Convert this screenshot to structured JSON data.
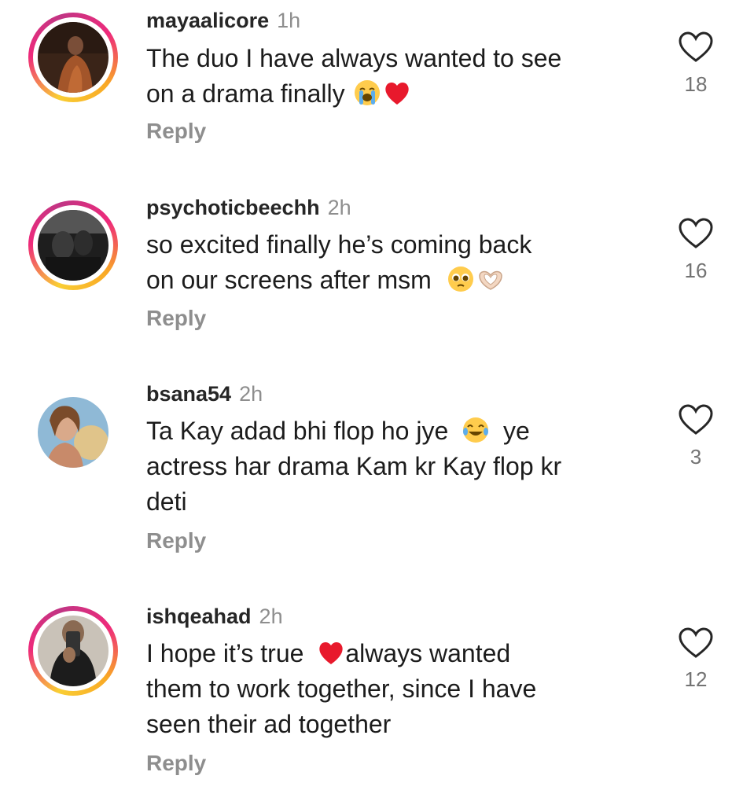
{
  "comments": [
    {
      "username": "mayaalicore",
      "time": "1h",
      "lines": [
        "The duo I have always wanted to see",
        "on a drama finally"
      ],
      "emojis": [
        "loudly-crying-face-emoji",
        "red-heart-emoji"
      ],
      "reply_label": "Reply",
      "likes": "18",
      "has_story_ring": true
    },
    {
      "username": "psychoticbeechh",
      "time": "2h",
      "lines": [
        "so excited finally he’s coming back",
        "on our screens after msm"
      ],
      "emojis": [
        "pleading-face-emoji",
        "heart-hands-emoji"
      ],
      "reply_label": "Reply",
      "likes": "16",
      "has_story_ring": true
    },
    {
      "username": "bsana54",
      "time": "2h",
      "lines": [
        "Ta Kay adad bhi flop ho jye",
        "ye",
        "actress har drama Kam kr Kay flop kr",
        "deti"
      ],
      "emojis": [
        "tears-of-joy-emoji"
      ],
      "reply_label": "Reply",
      "likes": "3",
      "has_story_ring": false
    },
    {
      "username": "ishqeahad",
      "time": "2h",
      "lines": [
        "I hope it’s true",
        "always wanted",
        "them to work together, since I have",
        "seen their ad together"
      ],
      "emojis": [
        "red-heart-emoji"
      ],
      "reply_label": "Reply",
      "likes": "12",
      "has_story_ring": true
    }
  ],
  "colors": {
    "username": "#262626",
    "secondary": "#8e8e8e",
    "text": "#1c1c1c",
    "like_count": "#737373",
    "story_ring_start": "#f9ce34",
    "story_ring_mid": "#ee2a7b",
    "story_ring_end": "#c13584"
  },
  "icons": {
    "like": "heart-outline-icon"
  }
}
